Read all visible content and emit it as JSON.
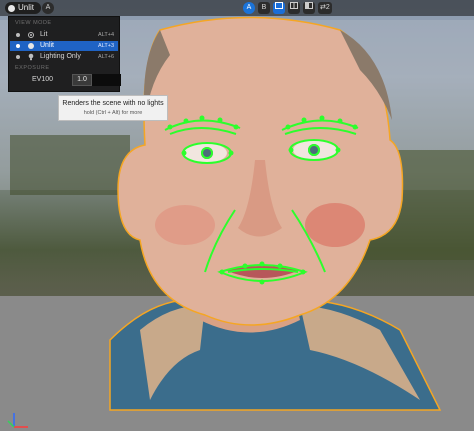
{
  "toolbar": {
    "view_mode_label": "Unlit",
    "badge_left": "A",
    "right_buttons": [
      "A",
      "B",
      "",
      "",
      "",
      "2"
    ]
  },
  "view_menu": {
    "section_view_mode": "VIEW MODE",
    "items": [
      {
        "label": "Lit",
        "shortcut": "ALT+4",
        "icon": "sun-icon",
        "selected": false
      },
      {
        "label": "Unlit",
        "shortcut": "ALT+3",
        "icon": "sphere-icon",
        "selected": true
      },
      {
        "label": "Lighting Only",
        "shortcut": "ALT+6",
        "icon": "bulb-icon",
        "selected": false
      }
    ],
    "section_exposure": "EXPOSURE",
    "ev_label": "EV100",
    "ev_value": "1.0"
  },
  "tooltip": {
    "title": "Renders the scene with no lights",
    "hint": "hold (Ctrl + Alt) for more"
  },
  "colors": {
    "accent": "#1f63c4",
    "landmark_green": "#2cff2c",
    "outline_orange": "#f5a623"
  }
}
